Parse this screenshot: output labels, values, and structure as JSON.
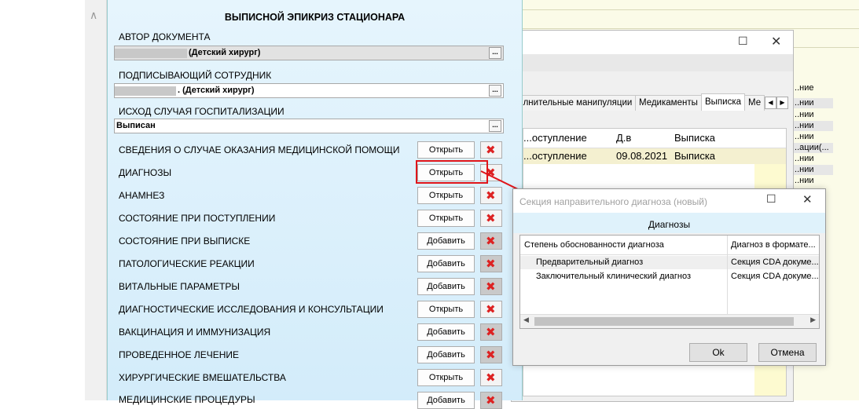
{
  "form": {
    "title": "ВЫПИСНОЙ ЭПИКРИЗ СТАЦИОНАРА",
    "author_label": "АВТОР ДОКУМЕНТА",
    "author_value": "(Детский хирург)",
    "signer_label": "ПОДПИСЫВАЮЩИЙ СОТРУДНИК",
    "signer_value": ". (Детский хирург)",
    "outcome_label": "ИСХОД СЛУЧАЯ ГОСПИТАЛИЗАЦИИ",
    "outcome_value": "Выписан",
    "dots": "...",
    "sections": [
      {
        "label": "СВЕДЕНИЯ О СЛУЧАЕ ОКАЗАНИЯ МЕДИЦИНСКОЙ ПОМОЩИ",
        "button": "Открыть"
      },
      {
        "label": "ДИАГНОЗЫ",
        "button": "Открыть"
      },
      {
        "label": "АНАМНЕЗ",
        "button": "Открыть"
      },
      {
        "label": "СОСТОЯНИЕ ПРИ ПОСТУПЛЕНИИ",
        "button": "Открыть"
      },
      {
        "label": "СОСТОЯНИЕ ПРИ ВЫПИСКЕ",
        "button": "Добавить"
      },
      {
        "label": "ПАТОЛОГИЧЕСКИЕ РЕАКЦИИ",
        "button": "Добавить"
      },
      {
        "label": "ВИТАЛЬНЫЕ ПАРАМЕТРЫ",
        "button": "Добавить"
      },
      {
        "label": "ДИАГНОСТИЧЕСКИЕ ИССЛЕДОВАНИЯ И КОНСУЛЬТАЦИИ",
        "button": "Открыть"
      },
      {
        "label": "ВАКЦИНАЦИЯ И ИММУНИЗАЦИЯ",
        "button": "Добавить"
      },
      {
        "label": "ПРОВЕДЕННОЕ ЛЕЧЕНИЕ",
        "button": "Добавить"
      },
      {
        "label": "ХИРУРГИЧЕСКИЕ ВМЕШАТЕЛЬСТВА",
        "button": "Открыть"
      },
      {
        "label": "МЕДИЦИНСКИЕ ПРОЦЕДУРЫ",
        "button": "Добавить"
      }
    ]
  },
  "background_window": {
    "tabs": [
      "...лнительные манипуляции",
      "Медикаменты",
      "Выписка",
      "Ме"
    ],
    "table_headers": [
      "...оступление",
      "Д.в",
      "Выписка"
    ],
    "table_row": [
      "...оступление",
      "09.08.2021",
      "Выписка"
    ],
    "side_header": "...ние",
    "side_cells": [
      "...нии",
      "...нии",
      "...нии",
      "...нии",
      "...ации(...",
      "...нии",
      "...нии",
      "...нии"
    ]
  },
  "dialog": {
    "title": "Секция направительного диагноза (новый)",
    "header": "Диагнозы",
    "columns": [
      "Степень обоснованности диагноза",
      "Диагноз в формате..."
    ],
    "rows": [
      [
        "Предварительный диагноз",
        "Секция CDA докуме..."
      ],
      [
        "Заключительный клинический диагноз",
        "Секция CDA докуме..."
      ]
    ],
    "ok_label": "Ok",
    "cancel_label": "Отмена"
  },
  "colors": {
    "highlight": "#e0151a",
    "form_bg": "#dcf0fb",
    "delete_icon": "#d22222"
  }
}
